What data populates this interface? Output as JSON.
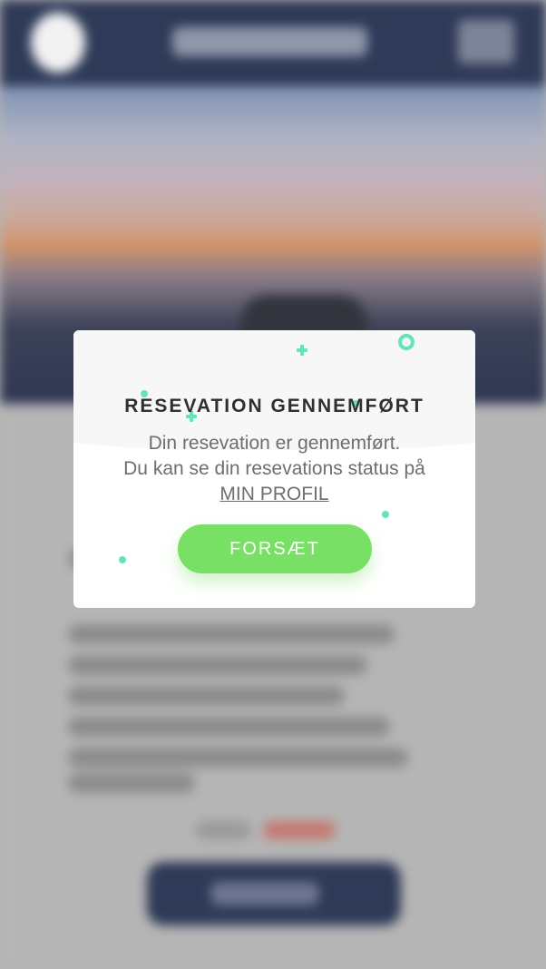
{
  "modal": {
    "title": "RESEVATION GENNEMFØRT",
    "message_line1": "Din resevation er gennemført.",
    "message_line2": "Du kan se din resevations status på",
    "profile_link": "MIN PROFIL ",
    "continue_button": "FORSÆT"
  },
  "colors": {
    "header_navy": "#2f3a58",
    "accent_green": "#78e065",
    "confetti_mint": "#62e6b5",
    "backdrop_gray": "#b5b5b5"
  },
  "icons": {
    "logo": "app-logo",
    "menu": "hamburger-menu-icon"
  }
}
